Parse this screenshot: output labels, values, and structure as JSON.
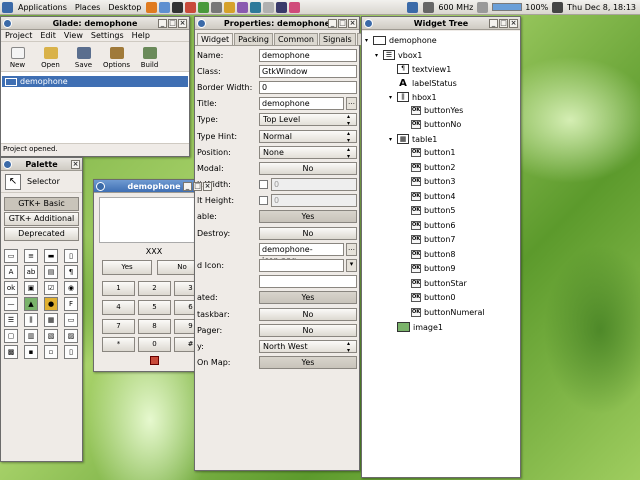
{
  "panel": {
    "menus": [
      "Applications",
      "Places",
      "Desktop"
    ],
    "cpu": "600 MHz",
    "battery": "100%",
    "battery_level": 1.0,
    "clock": "Thu Dec 8, 18:13"
  },
  "glade": {
    "title": "Glade: demophone",
    "menu": [
      "Project",
      "Edit",
      "View",
      "Settings",
      "Help"
    ],
    "tools": [
      "New",
      "Open",
      "Save",
      "Options",
      "Build"
    ],
    "project_item": "demophone",
    "status": "Project opened."
  },
  "palette": {
    "title": "Palette",
    "selector": "Selector",
    "groups": [
      "GTK+ Basic",
      "GTK+ Additional",
      "Deprecated"
    ]
  },
  "demophone": {
    "title": "demophone",
    "label": "XXX",
    "yes": "Yes",
    "no": "No",
    "keys": [
      "1",
      "2",
      "3",
      "4",
      "5",
      "6",
      "7",
      "8",
      "9",
      "*",
      "0",
      "#"
    ]
  },
  "properties": {
    "title": "Properties: demophone",
    "tabs": [
      "Widget",
      "Packing",
      "Common",
      "Signals"
    ],
    "rows": [
      {
        "label": "Name:",
        "value": "demophone"
      },
      {
        "label": "Class:",
        "value": "GtkWindow"
      },
      {
        "label": "Border Width:",
        "value": "0"
      },
      {
        "label": "Title:",
        "value": "demophone"
      },
      {
        "label": "Type:",
        "value": "Top Level"
      },
      {
        "label": "Type Hint:",
        "value": "Normal"
      },
      {
        "label": "Position:",
        "value": "None"
      },
      {
        "label": "Modal:",
        "value": "No"
      },
      {
        "label": "lt Width:",
        "value": "0"
      },
      {
        "label": "lt Height:",
        "value": "0"
      },
      {
        "label": "able:",
        "value": "Yes"
      },
      {
        "label": "Destroy:",
        "value": "No"
      },
      {
        "label": "",
        "value": "demophone-icon.png"
      },
      {
        "label": "d Icon:",
        "value": ""
      },
      {
        "label": "",
        "value": ""
      },
      {
        "label": "ated:",
        "value": "Yes"
      },
      {
        "label": "taskbar:",
        "value": "No"
      },
      {
        "label": "Pager:",
        "value": "No"
      },
      {
        "label": "y:",
        "value": "North West"
      },
      {
        "label": "On Map:",
        "value": "Yes"
      }
    ]
  },
  "tree": {
    "title": "Widget Tree",
    "items": [
      "demophone",
      "vbox1",
      "textview1",
      "labelStatus",
      "hbox1",
      "buttonYes",
      "buttonNo",
      "table1",
      "button1",
      "button2",
      "button3",
      "button4",
      "button5",
      "button6",
      "button7",
      "button8",
      "button9",
      "buttonStar",
      "button0",
      "buttonNumeral",
      "image1"
    ]
  },
  "colors": {
    "title_active": "#3f6fb3",
    "window_bg": "#efebe7"
  }
}
